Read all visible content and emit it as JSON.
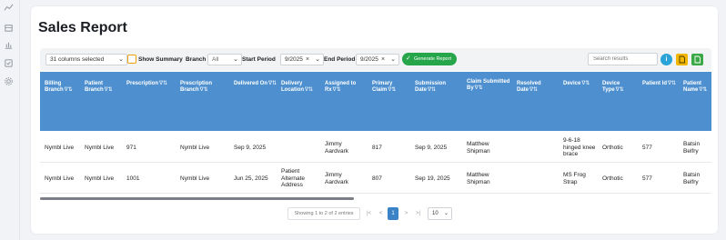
{
  "sidebar": {
    "icons": [
      "grid-dots-icon",
      "building-icon",
      "bar-chart-icon",
      "checkbox-icon",
      "gear-icon"
    ]
  },
  "page": {
    "title": "Sales Report"
  },
  "toolbar": {
    "columns_select": "31 columns selected",
    "show_summary_label": "Show Summary",
    "branch_label": "Branch",
    "branch_value": "All",
    "start_period_label": "Start Period",
    "start_period_value": "9/2025",
    "end_period_label": "End Period",
    "end_period_value": "9/2025",
    "generate_label": "Generate Report",
    "search_placeholder": "Search results",
    "info_label": "i",
    "colors": {
      "accent": "#4d8fcf",
      "generate": "#27a54a",
      "info": "#2aa4d8",
      "pdf": "#f2b705",
      "excel": "#3aa845"
    }
  },
  "table": {
    "headers": [
      "Billing Branch",
      "Patient Branch",
      "Prescription",
      "Prescription Branch",
      "Delivered On",
      "Delivery Location",
      "Assigned to Rx",
      "Primary Claim",
      "Submission Date",
      "Claim Submitted By",
      "Resolved Date",
      "Device",
      "Device Type",
      "Patient Id",
      "Patient Name"
    ],
    "rows": [
      [
        "Nymbl Live",
        "Nymbl Live",
        "971",
        "Nymbl Live",
        "Sep 9, 2025",
        "",
        "Jimmy Aardvark",
        "817",
        "Sep 9, 2025",
        "Matthew Shipman",
        "",
        "9-6-18 hinged knee brace",
        "Orthotic",
        "577",
        "Batsin Belfry"
      ],
      [
        "Nymbl Live",
        "Nymbl Live",
        "1001",
        "Nymbl Live",
        "Jun 25, 2025",
        "Patient Alternate Address",
        "Jimmy Aardvark",
        "807",
        "Sep 19, 2025",
        "Matthew Shipman",
        "",
        "MS Frog Strap",
        "Orthotic",
        "577",
        "Batsin Belfry"
      ]
    ]
  },
  "pagination": {
    "info": "Showing 1 to 2 of 2 entries",
    "first": "|<",
    "prev": "<",
    "current": "1",
    "next": ">",
    "last": ">|",
    "page_size": "10"
  }
}
